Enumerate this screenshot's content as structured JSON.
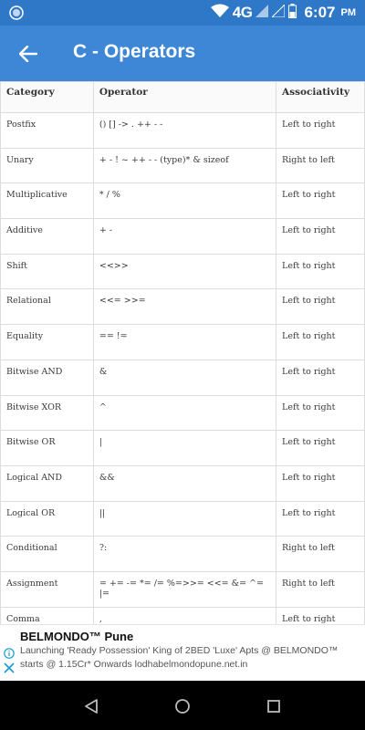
{
  "status_bar": {
    "network": "4G",
    "time": "6:07",
    "ampm": "PM"
  },
  "app_bar": {
    "title": "C - Operators"
  },
  "table": {
    "headers": [
      "Category",
      "Operator",
      "Associativity"
    ],
    "rows": [
      [
        "Postfix",
        "() [] -> . ++ - -",
        "Left to right"
      ],
      [
        "Unary",
        "+ - ! ~ ++ - - (type)* & sizeof",
        "Right to left"
      ],
      [
        "Multiplicative",
        "* / %",
        "Left to right"
      ],
      [
        "Additive",
        "+ -",
        "Left to right"
      ],
      [
        "Shift",
        "<<>>",
        "Left to right"
      ],
      [
        "Relational",
        "<<= >>=",
        "Left to right"
      ],
      [
        "Equality",
        "== !=",
        "Left to right"
      ],
      [
        "Bitwise AND",
        "&",
        "Left to right"
      ],
      [
        "Bitwise XOR",
        "^",
        "Left to right"
      ],
      [
        "Bitwise OR",
        "|",
        "Left to right"
      ],
      [
        "Logical AND",
        "&&",
        "Left to right"
      ],
      [
        "Logical OR",
        "||",
        "Left to right"
      ],
      [
        "Conditional",
        "?:",
        "Right to left"
      ],
      [
        "Assignment",
        "= += -= *= /= %=>>= <<= &= ^= |=",
        "Right to left"
      ],
      [
        "Comma",
        ",",
        "Left to right"
      ]
    ]
  },
  "ad": {
    "title": "BELMONDO™ Pune",
    "line1": "Launching 'Ready Possession' King of 2BED 'Luxe' Apts @ BELMONDO™",
    "line2": "starts @ 1.15Cr* Onwards lodhabelmondopune.net.in",
    "info_icon": "info-icon",
    "close_icon": "close-icon"
  },
  "colors": {
    "status_bar": "#2f78c8",
    "app_bar": "#3d87d6",
    "ad_icon": "#1a9bd7"
  }
}
